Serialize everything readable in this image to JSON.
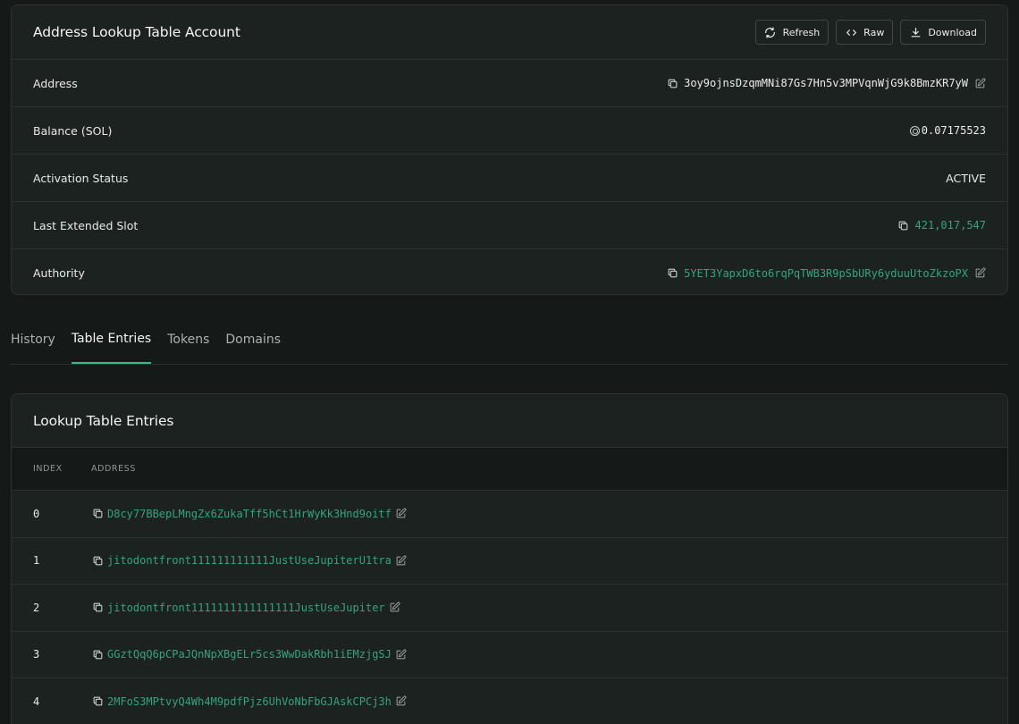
{
  "account": {
    "title": "Address Lookup Table Account",
    "actions": {
      "refresh": "Refresh",
      "raw": "Raw",
      "download": "Download"
    },
    "rows": {
      "address": {
        "label": "Address",
        "value": "3oy9ojnsDzqmMNi87Gs7Hn5v3MPVqnWjG9k8BmzKR7yW"
      },
      "balance": {
        "label": "Balance (SOL)",
        "value": "0.07175523"
      },
      "status": {
        "label": "Activation Status",
        "value": "ACTIVE"
      },
      "slot": {
        "label": "Last Extended Slot",
        "value": "421,017,547"
      },
      "authority": {
        "label": "Authority",
        "value": "5YET3YapxD6to6rqPqTWB3R9pSbURy6yduuUtoZkzoPX"
      }
    }
  },
  "tabs": [
    "History",
    "Table Entries",
    "Tokens",
    "Domains"
  ],
  "active_tab": "Table Entries",
  "entries": {
    "title": "Lookup Table Entries",
    "columns": {
      "index": "INDEX",
      "address": "ADDRESS"
    },
    "rows": [
      {
        "index": "0",
        "address": "D8cy77BBepLMngZx6ZukaTff5hCt1HrWyKk3Hnd9oitf"
      },
      {
        "index": "1",
        "address": "jitodontfront111111111111JustUseJupiterU1tra"
      },
      {
        "index": "2",
        "address": "jitodontfront1111111111111111JustUseJupiter"
      },
      {
        "index": "3",
        "address": "GGztQqQ6pCPaJQnNpXBgELr5cs3WwDakRbh1iEMzjgSJ"
      },
      {
        "index": "4",
        "address": "2MFoS3MPtvyQ4Wh4M9pdfPjz6UhVoNbFbGJAskCPCj3h"
      }
    ]
  },
  "colors": {
    "background": "#151918",
    "card": "#1c2220",
    "accent_green": "#35a37f",
    "tab_indicator": "#2fbf8f"
  },
  "icons": {
    "refresh": "refresh-icon",
    "raw": "code-icon",
    "download": "download-icon",
    "copy": "copy-icon",
    "edit": "edit-icon",
    "sol": "sol-coin-icon"
  }
}
